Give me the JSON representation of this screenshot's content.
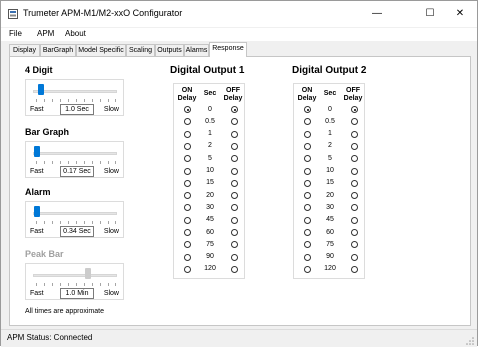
{
  "window": {
    "title": "Trumeter APM-M1/M2-xxO Configurator",
    "minimize": "—",
    "maximize": "☐",
    "close": "✕"
  },
  "menu": [
    "File",
    "APM",
    "About"
  ],
  "tabs": [
    "Display",
    "BarGraph",
    "Model Specific",
    "Scaling",
    "Outputs",
    "Alarms",
    "Response"
  ],
  "active_tab": "Response",
  "sliders": [
    {
      "title": "4 Digit",
      "value": "1.0 Sec",
      "fast": "Fast",
      "slow": "Slow",
      "enabled": true
    },
    {
      "title": "Bar Graph",
      "value": "0.17 Sec",
      "fast": "Fast",
      "slow": "Slow",
      "enabled": true
    },
    {
      "title": "Alarm",
      "value": "0.34 Sec",
      "fast": "Fast",
      "slow": "Slow",
      "enabled": true
    },
    {
      "title": "Peak Bar",
      "value": "1.0 Min",
      "fast": "Fast",
      "slow": "Slow",
      "enabled": false
    }
  ],
  "note": "All times are approximate",
  "outputs": [
    {
      "title": "Digital Output 1",
      "on_header": "ON Delay",
      "sec_header": "Sec",
      "off_header": "OFF Delay",
      "secs": [
        "0",
        "0.5",
        "1",
        "2",
        "5",
        "10",
        "15",
        "20",
        "30",
        "45",
        "60",
        "75",
        "90",
        "120"
      ],
      "on_selected": "0",
      "off_selected": "0"
    },
    {
      "title": "Digital Output 2",
      "on_header": "ON Delay",
      "sec_header": "Sec",
      "off_header": "OFF Delay",
      "secs": [
        "0",
        "0.5",
        "1",
        "2",
        "5",
        "10",
        "15",
        "20",
        "30",
        "45",
        "60",
        "75",
        "90",
        "120"
      ],
      "on_selected": "0",
      "off_selected": "0"
    }
  ],
  "status": "APM Status:  Connected"
}
